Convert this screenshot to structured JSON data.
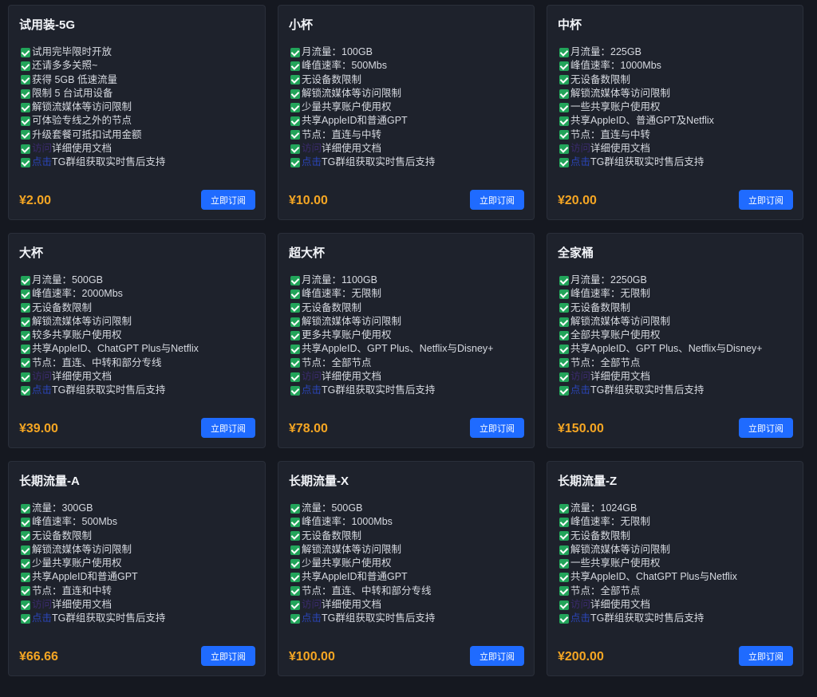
{
  "cards": [
    {
      "title": "试用装-5G",
      "price": "¥2.00",
      "button": "立即订阅",
      "features": [
        "试用完毕限时开放",
        "还请多多关照~",
        "获得 5GB 低速流量",
        "限制 5 台试用设备",
        "解锁流媒体等访问限制",
        "可体验专线之外的节点",
        "升级套餐可抵扣试用金额"
      ],
      "doc_link": "访问",
      "doc_text": "详细使用文档",
      "tg_link": "点击",
      "tg_text": "TG群组获取实时售后支持"
    },
    {
      "title": "小杯",
      "price": "¥10.00",
      "button": "立即订阅",
      "features": [
        "月流量：100GB",
        "峰值速率：500Mbs",
        "无设备数限制",
        "解锁流媒体等访问限制",
        "少量共享账户使用权",
        "共享AppleID和普通GPT",
        "节点：直连与中转"
      ],
      "doc_link": "访问",
      "doc_text": "详细使用文档",
      "tg_link": "点击",
      "tg_text": "TG群组获取实时售后支持"
    },
    {
      "title": "中杯",
      "price": "¥20.00",
      "button": "立即订阅",
      "features": [
        "月流量：225GB",
        "峰值速率：1000Mbs",
        "无设备数限制",
        "解锁流媒体等访问限制",
        "一些共享账户使用权",
        "共享AppleID、普通GPT及Netflix",
        "节点：直连与中转"
      ],
      "doc_link": "访问",
      "doc_text": "详细使用文档",
      "tg_link": "点击",
      "tg_text": "TG群组获取实时售后支持"
    },
    {
      "title": "大杯",
      "price": "¥39.00",
      "button": "立即订阅",
      "features": [
        "月流量：500GB",
        "峰值速率：2000Mbs",
        "无设备数限制",
        "解锁流媒体等访问限制",
        "较多共享账户使用权",
        "共享AppleID、ChatGPT Plus与Netflix",
        "节点：直连、中转和部分专线"
      ],
      "doc_link": "访问",
      "doc_text": "详细使用文档",
      "tg_link": "点击",
      "tg_text": "TG群组获取实时售后支持"
    },
    {
      "title": "超大杯",
      "price": "¥78.00",
      "button": "立即订阅",
      "features": [
        "月流量：1100GB",
        "峰值速率：无限制",
        "无设备数限制",
        "解锁流媒体等访问限制",
        "更多共享账户使用权",
        "共享AppleID、GPT Plus、Netflix与Disney+",
        "节点：全部节点"
      ],
      "doc_link": "访问",
      "doc_text": "详细使用文档",
      "tg_link": "点击",
      "tg_text": "TG群组获取实时售后支持"
    },
    {
      "title": "全家桶",
      "price": "¥150.00",
      "button": "立即订阅",
      "features": [
        "月流量：2250GB",
        "峰值速率：无限制",
        "无设备数限制",
        "解锁流媒体等访问限制",
        "全部共享账户使用权",
        "共享AppleID、GPT Plus、Netflix与Disney+",
        "节点：全部节点"
      ],
      "doc_link": "访问",
      "doc_text": "详细使用文档",
      "tg_link": "点击",
      "tg_text": "TG群组获取实时售后支持"
    },
    {
      "title": "长期流量-A",
      "price": "¥66.66",
      "button": "立即订阅",
      "features": [
        "流量：300GB",
        "峰值速率：500Mbs",
        "无设备数限制",
        "解锁流媒体等访问限制",
        "少量共享账户使用权",
        "共享AppleID和普通GPT",
        "节点：直连和中转"
      ],
      "doc_link": "访问",
      "doc_text": "详细使用文档",
      "tg_link": "点击",
      "tg_text": "TG群组获取实时售后支持"
    },
    {
      "title": "长期流量-X",
      "price": "¥100.00",
      "button": "立即订阅",
      "features": [
        "流量：500GB",
        "峰值速率：1000Mbs",
        "无设备数限制",
        "解锁流媒体等访问限制",
        "少量共享账户使用权",
        "共享AppleID和普通GPT",
        "节点：直连、中转和部分专线"
      ],
      "doc_link": "访问",
      "doc_text": "详细使用文档",
      "tg_link": "点击",
      "tg_text": "TG群组获取实时售后支持"
    },
    {
      "title": "长期流量-Z",
      "price": "¥200.00",
      "button": "立即订阅",
      "features": [
        "流量：1024GB",
        "峰值速率：无限制",
        "无设备数限制",
        "解锁流媒体等访问限制",
        "一些共享账户使用权",
        "共享AppleID、ChatGPT Plus与Netflix",
        "节点：全部节点"
      ],
      "doc_link": "访问",
      "doc_text": "详细使用文档",
      "tg_link": "点击",
      "tg_text": "TG群组获取实时售后支持"
    }
  ],
  "icons": {
    "feature": "check-icon"
  },
  "colors": {
    "background": "#151820",
    "card": "#1e222c",
    "price": "#f5a623",
    "button": "#1f6bff",
    "check": "#22a45a"
  }
}
